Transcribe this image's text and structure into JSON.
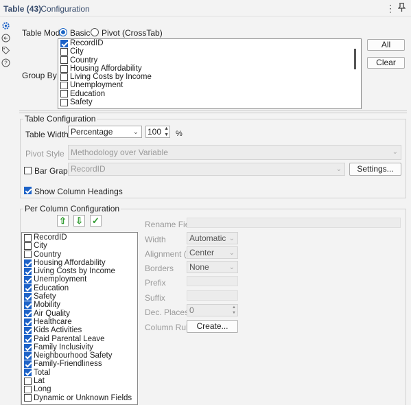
{
  "window": {
    "tool_name": "Table (43)",
    "subtitle": "- Configuration"
  },
  "sidebar": {
    "icons": [
      "gear-icon",
      "back-arrow-icon",
      "tag-icon",
      "help-icon"
    ]
  },
  "table_mode": {
    "label": "Table Mode",
    "basic_label": "Basic",
    "pivot_label": "Pivot (CrossTab)",
    "selected": "Basic"
  },
  "group_by": {
    "label": "Group By",
    "items": [
      {
        "label": "RecordID",
        "checked": true
      },
      {
        "label": "City",
        "checked": false
      },
      {
        "label": "Country",
        "checked": false
      },
      {
        "label": "Housing Affordability",
        "checked": false
      },
      {
        "label": "Living Costs by Income",
        "checked": false
      },
      {
        "label": "Unemployment",
        "checked": false
      },
      {
        "label": "Education",
        "checked": false
      },
      {
        "label": "Safety",
        "checked": false
      }
    ],
    "all_button": "All",
    "clear_button": "Clear"
  },
  "table_config": {
    "legend": "Table Configuration",
    "width_label": "Table Width",
    "width_mode": "Percentage",
    "width_value": "100",
    "width_unit": "%",
    "pivot_style_label": "Pivot Style",
    "pivot_style_value": "Methodology over Variable",
    "bar_graph_label": "Bar Graph",
    "bar_graph_checked": false,
    "bar_graph_field": "RecordID",
    "settings_button": "Settings...",
    "show_headings_label": "Show Column Headings",
    "show_headings_checked": true
  },
  "per_column": {
    "legend": "Per Column Configuration",
    "fields": [
      {
        "label": "RecordID",
        "checked": false
      },
      {
        "label": "City",
        "checked": false
      },
      {
        "label": "Country",
        "checked": false
      },
      {
        "label": "Housing Affordability",
        "checked": true
      },
      {
        "label": "Living Costs by Income",
        "checked": true
      },
      {
        "label": "Unemployment",
        "checked": true
      },
      {
        "label": "Education",
        "checked": true
      },
      {
        "label": "Safety",
        "checked": true
      },
      {
        "label": "Mobility",
        "checked": true
      },
      {
        "label": "Air Quality",
        "checked": true
      },
      {
        "label": "Healthcare",
        "checked": true
      },
      {
        "label": "Kids Activities",
        "checked": true
      },
      {
        "label": "Paid Parental Leave",
        "checked": true
      },
      {
        "label": "Family Inclusivity",
        "checked": true
      },
      {
        "label": "Neighbourhood Safety",
        "checked": true
      },
      {
        "label": "Family-Friendliness",
        "checked": true
      },
      {
        "label": "Total",
        "checked": true
      },
      {
        "label": "Lat",
        "checked": false
      },
      {
        "label": "Long",
        "checked": false
      },
      {
        "label": "Dynamic or Unknown Fields",
        "checked": false
      }
    ],
    "rename_label": "Rename Field",
    "width_label": "Width",
    "width_value": "Automatic",
    "alignment_label": "Alignment (H)",
    "alignment_value": "Center",
    "borders_label": "Borders",
    "borders_value": "None",
    "prefix_label": "Prefix",
    "suffix_label": "Suffix",
    "dec_places_label": "Dec. Places",
    "dec_places_value": "0",
    "column_rules_label": "Column Rules",
    "create_button": "Create..."
  }
}
